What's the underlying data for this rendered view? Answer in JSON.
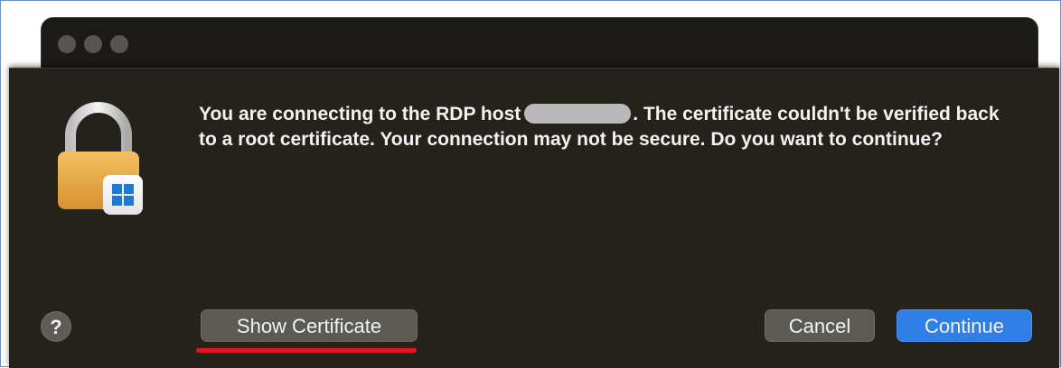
{
  "dialog": {
    "message_before_host": "You are connecting to the RDP host",
    "message_after_host": ". The certificate couldn't be verified back to a root certificate. Your connection may not be secure. Do you want to continue?",
    "host_icon": "windows-logo-icon",
    "lock_icon": "lock-icon"
  },
  "buttons": {
    "help_label": "?",
    "show_certificate_label": "Show Certificate",
    "cancel_label": "Cancel",
    "continue_label": "Continue"
  },
  "colors": {
    "sheet_background": "#24221a",
    "primary_button": "#2f7fe6",
    "secondary_button": "#5c5a55",
    "annotation_underline": "#e51420"
  }
}
